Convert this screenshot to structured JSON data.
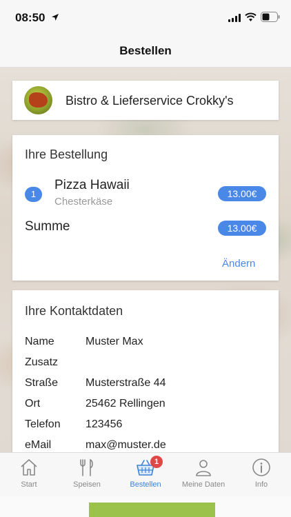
{
  "status_bar": {
    "time": "08:50",
    "icons": [
      "location-arrow-icon",
      "signal-icon",
      "wifi-icon",
      "battery-icon"
    ]
  },
  "nav": {
    "title": "Bestellen"
  },
  "shop": {
    "name": "Bistro & Lieferservice Crokky's",
    "logo_icon": "crocodile-logo"
  },
  "order": {
    "title": "Ihre Bestellung",
    "items": [
      {
        "quantity": "1",
        "name": "Pizza Hawaii",
        "variant": "Chesterkäse",
        "price": "13.00€"
      }
    ],
    "sum_label": "Summe",
    "sum_price": "13.00€",
    "edit_label": "Ändern"
  },
  "contact": {
    "title": "Ihre Kontaktdaten",
    "rows": [
      {
        "label": "Name",
        "value": "Muster Max"
      },
      {
        "label": "Zusatz",
        "value": ""
      },
      {
        "label": "Straße",
        "value": "Musterstraße 44"
      },
      {
        "label": "Ort",
        "value": "25462 Rellingen"
      },
      {
        "label": "Telefon",
        "value": "123456"
      },
      {
        "label": "eMail",
        "value": "max@muster.de"
      }
    ]
  },
  "tab_bar": {
    "tabs": [
      {
        "label": "Start",
        "icon": "home-icon",
        "active": false
      },
      {
        "label": "Speisen",
        "icon": "fork-knife-icon",
        "active": false
      },
      {
        "label": "Bestellen",
        "icon": "basket-icon",
        "active": true,
        "badge": "1"
      },
      {
        "label": "Meine Daten",
        "icon": "person-icon",
        "active": false
      },
      {
        "label": "Info",
        "icon": "info-icon",
        "active": false
      }
    ]
  },
  "colors": {
    "accent": "#4a88e8",
    "tab_active": "#3b82d6",
    "badge_red": "#e04848",
    "action_green": "#9bc24a"
  }
}
